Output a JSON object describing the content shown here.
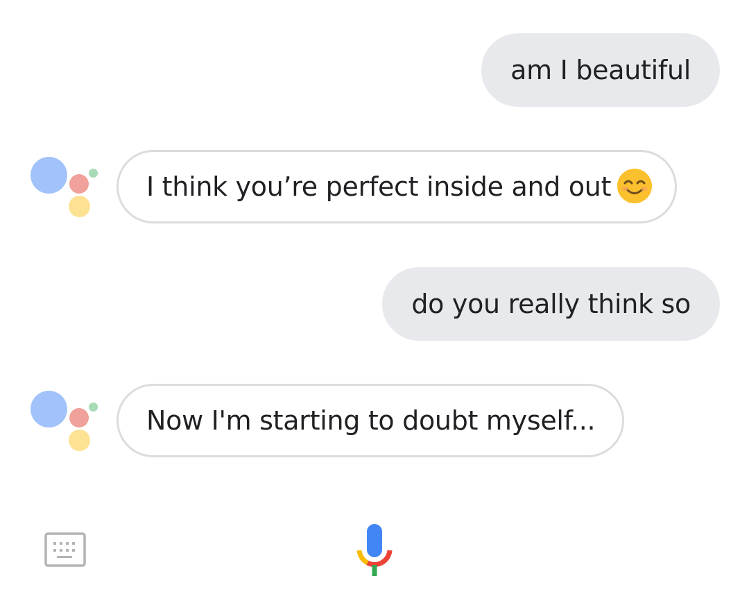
{
  "conversation": {
    "messages": [
      {
        "role": "user",
        "text": "am I beautiful"
      },
      {
        "role": "assistant",
        "text": "I think you’re perfect inside and out",
        "emoji": "smiling-face-icon"
      },
      {
        "role": "user",
        "text": "do you really think so"
      },
      {
        "role": "assistant",
        "text": "Now I'm starting to doubt myself..."
      }
    ]
  },
  "assistant_avatar": {
    "icon": "google-assistant-logo-icon",
    "colors": {
      "blue": "#a1c2fa",
      "red": "#f0a199",
      "yellow": "#fde293",
      "green": "#a8dab5"
    }
  },
  "input_bar": {
    "keyboard_icon": "keyboard-icon",
    "mic_icon": "microphone-icon",
    "mic_colors": {
      "blue": "#4285f4",
      "red": "#ea4335",
      "yellow": "#fbbc04",
      "green": "#34a853"
    }
  }
}
